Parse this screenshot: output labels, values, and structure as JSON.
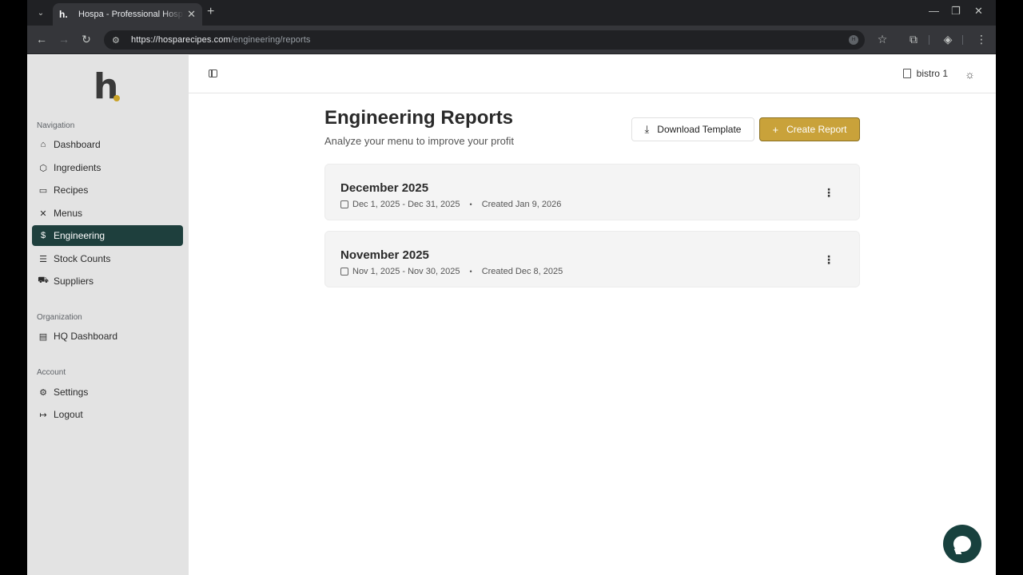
{
  "browser": {
    "tab_title": "Hospa - Professional Hospitalit",
    "tab_favicon": "h.",
    "url": "https://hosparecipes.com/engineering/reports",
    "url_host": "https://hosparecipes.com",
    "url_path": "/engineering/reports",
    "extension_badge": "H"
  },
  "logo": {
    "text": "h"
  },
  "sidebar": {
    "navigation_label": "Navigation",
    "items": [
      {
        "label": "Dashboard",
        "icon": "home-icon"
      },
      {
        "label": "Ingredients",
        "icon": "box-icon"
      },
      {
        "label": "Recipes",
        "icon": "book-icon"
      },
      {
        "label": "Menus",
        "icon": "utensils-icon"
      },
      {
        "label": "Engineering",
        "icon": "dollar-icon",
        "active": true
      },
      {
        "label": "Stock Counts",
        "icon": "stack-icon"
      },
      {
        "label": "Suppliers",
        "icon": "truck-icon"
      }
    ],
    "organization_label": "Organization",
    "org_items": [
      {
        "label": "HQ Dashboard",
        "icon": "building-icon"
      }
    ],
    "account_label": "Account",
    "account_items": [
      {
        "label": "Settings",
        "icon": "gear-icon"
      },
      {
        "label": "Logout",
        "icon": "logout-icon"
      }
    ]
  },
  "topbar": {
    "location": "bistro 1"
  },
  "main": {
    "title": "Engineering Reports",
    "subtitle": "Analyze your menu to improve your profit",
    "download_label": "Download Template",
    "create_label": "Create Report",
    "reports": [
      {
        "title": "December 2025",
        "range": "Dec 1, 2025 - Dec 31, 2025",
        "created": "Created Jan 9, 2026"
      },
      {
        "title": "November 2025",
        "range": "Nov 1, 2025 - Nov 30, 2025",
        "created": "Created Dec 8, 2025"
      }
    ]
  },
  "colors": {
    "accent": "#c9a23a",
    "active_nav": "#1e3f3d",
    "chat": "#18413e"
  }
}
